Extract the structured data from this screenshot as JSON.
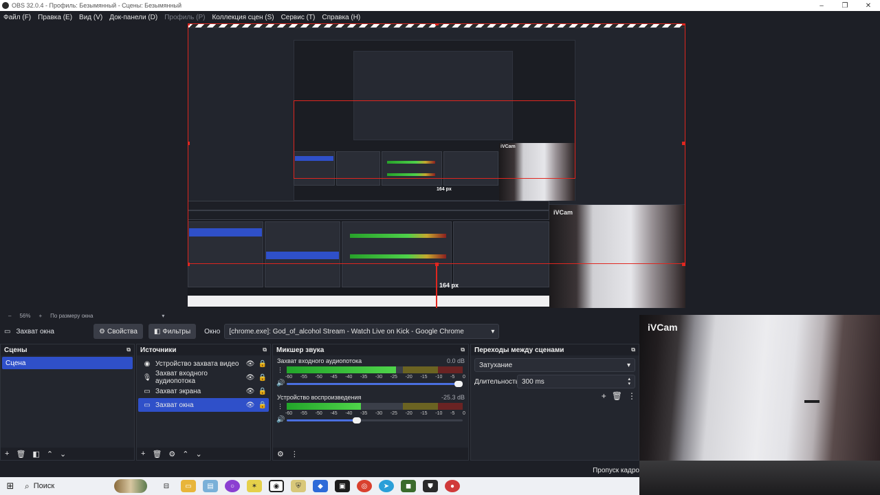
{
  "titlebar": {
    "title": "OBS 32.0.4 - Профиль: Безымянный - Сцены: Безымянный",
    "minimize": "–",
    "maximize": "❐",
    "close": "✕"
  },
  "menu": [
    {
      "label": "Файл (F)",
      "disabled": false
    },
    {
      "label": "Правка (E)",
      "disabled": false
    },
    {
      "label": "Вид (V)",
      "disabled": false
    },
    {
      "label": "Док-панели (D)",
      "disabled": false
    },
    {
      "label": "Профиль (P)",
      "disabled": true
    },
    {
      "label": "Коллекция сцен (S)",
      "disabled": false
    },
    {
      "label": "Сервис (T)",
      "disabled": false
    },
    {
      "label": "Справка (H)",
      "disabled": false
    }
  ],
  "preview": {
    "px_label": "164 px",
    "mini_px_label": "164 px",
    "ivcam_label": "iVCam",
    "mini_ivcam_label": "iVCam"
  },
  "zoom": {
    "minus": "–",
    "value": "56%",
    "plus": "+",
    "mode": "По размеру окна"
  },
  "source_toolbar": {
    "selected_source": "Захват окна",
    "properties_label": "Свойства",
    "filters_label": "Фильтры",
    "window_label": "Окно",
    "window_value": "[chrome.exe]: God_of_alcohol Stream - Watch Live on Kick - Google Chrome"
  },
  "scenes": {
    "title": "Сцены",
    "items": [
      "Сцена"
    ]
  },
  "sources": {
    "title": "Источники",
    "items": [
      {
        "name": "Устройство захвата видео",
        "icon": "camera-icon",
        "selected": false
      },
      {
        "name": "Захват входного аудиопотока",
        "icon": "microphone-icon",
        "selected": false
      },
      {
        "name": "Захват экрана",
        "icon": "monitor-icon",
        "selected": false
      },
      {
        "name": "Захват окна",
        "icon": "window-icon",
        "selected": true
      }
    ]
  },
  "mixer": {
    "title": "Микшер звука",
    "scale": [
      "-60",
      "-55",
      "-50",
      "-45",
      "-40",
      "-35",
      "-30",
      "-25",
      "-20",
      "-15",
      "-10",
      "-5",
      "0"
    ],
    "channels": [
      {
        "name": "Захват входного аудиопотока",
        "db": "0.0 dB",
        "level": 0.62,
        "volume": 1.0
      },
      {
        "name": "Устройство воспроизведения",
        "db": "-25.3 dB",
        "level": 0.42,
        "volume": 0.42
      }
    ]
  },
  "transitions": {
    "title": "Переходы между сценами",
    "type": "Затухание",
    "duration_label": "Длительность",
    "duration_value": "300 ms"
  },
  "status": {
    "text": "Пропуск кадро"
  },
  "taskbar": {
    "search_placeholder": "Поиск"
  },
  "colors": {
    "accent": "#2f50c9",
    "red_guides": "#e0261f",
    "background": "#1d1f26"
  }
}
